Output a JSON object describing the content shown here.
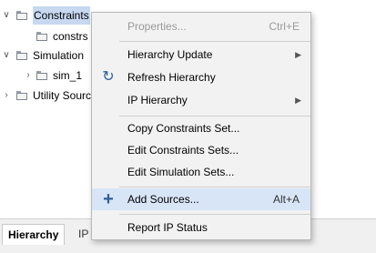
{
  "tree": {
    "rows": [
      {
        "label": "Constraints",
        "arrow": "∨"
      },
      {
        "label": "constrs"
      },
      {
        "label": "Simulation",
        "arrow": "∨"
      },
      {
        "label": "sim_1",
        "arrow": "›"
      },
      {
        "label": "Utility Sourc",
        "arrow": "›"
      }
    ]
  },
  "tabs": {
    "active": "Hierarchy",
    "inactive": "IP S"
  },
  "menu": {
    "items": [
      {
        "label": "Properties...",
        "shortcut": "Ctrl+E",
        "disabled": true
      },
      {
        "label": "Hierarchy Update",
        "submenu": "▶"
      },
      {
        "label": "Refresh Hierarchy",
        "icon": "↻"
      },
      {
        "label": "IP Hierarchy",
        "submenu": "▶"
      },
      {
        "label": "Copy Constraints Set..."
      },
      {
        "label": "Edit Constraints Sets..."
      },
      {
        "label": "Edit Simulation Sets..."
      },
      {
        "label": "Add Sources...",
        "shortcut": "Alt+A",
        "icon": "+",
        "highlighted": true
      },
      {
        "label": "Report IP Status"
      }
    ]
  }
}
